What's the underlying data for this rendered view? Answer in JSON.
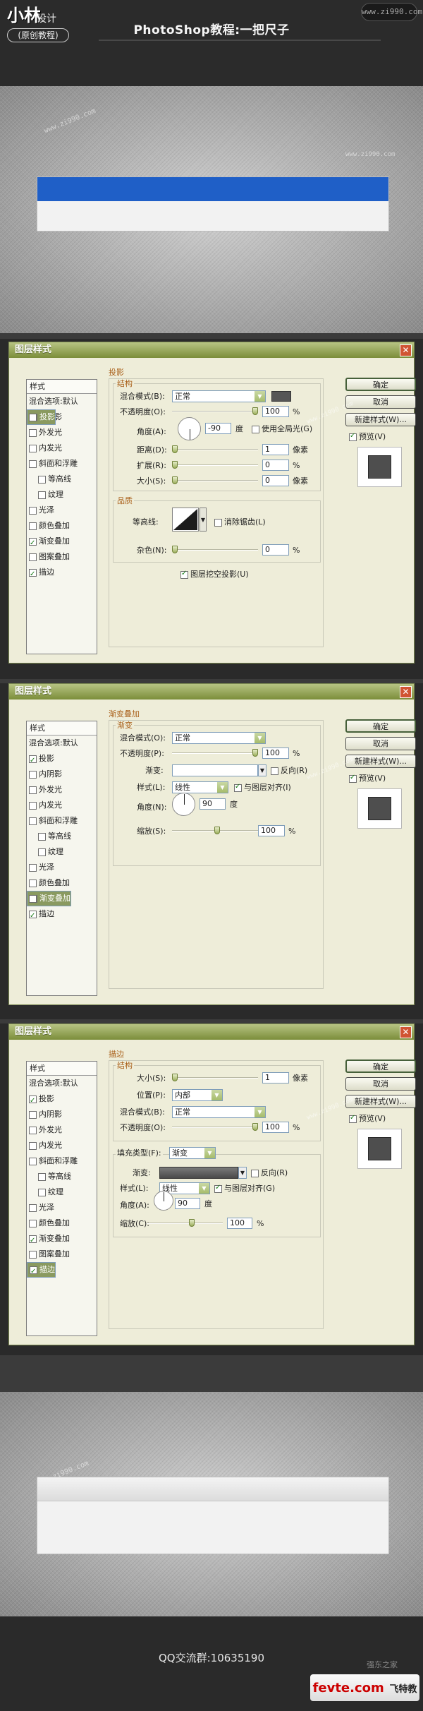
{
  "header": {
    "logo": "小林",
    "logo_sub": "设计",
    "badge": "(原创教程)",
    "title": "PhotoShop教程:一把尺子",
    "site": "www.zi990.com",
    "site_small": "www.zi990.com"
  },
  "watermark": "www.zi990.com",
  "dialogs": [
    {
      "title": "图层样式",
      "close": "✕",
      "sidebar_header": "样式",
      "sidebar": [
        {
          "label": "混合选项:默认",
          "check": false,
          "sub": false,
          "selected": false,
          "hasbox": false
        },
        {
          "label": "投影",
          "check": true,
          "sub": false,
          "selected": true,
          "hasbox": true
        },
        {
          "label": "内阴影",
          "check": false,
          "sub": false,
          "selected": false,
          "hasbox": true
        },
        {
          "label": "外发光",
          "check": false,
          "sub": false,
          "selected": false,
          "hasbox": true
        },
        {
          "label": "内发光",
          "check": false,
          "sub": false,
          "selected": false,
          "hasbox": true
        },
        {
          "label": "斜面和浮雕",
          "check": false,
          "sub": false,
          "selected": false,
          "hasbox": true
        },
        {
          "label": "等高线",
          "check": false,
          "sub": true,
          "selected": false,
          "hasbox": true
        },
        {
          "label": "纹理",
          "check": false,
          "sub": true,
          "selected": false,
          "hasbox": true
        },
        {
          "label": "光泽",
          "check": false,
          "sub": false,
          "selected": false,
          "hasbox": true
        },
        {
          "label": "颜色叠加",
          "check": false,
          "sub": false,
          "selected": false,
          "hasbox": true
        },
        {
          "label": "渐变叠加",
          "check": true,
          "sub": false,
          "selected": false,
          "hasbox": true
        },
        {
          "label": "图案叠加",
          "check": false,
          "sub": false,
          "selected": false,
          "hasbox": true
        },
        {
          "label": "描边",
          "check": true,
          "sub": false,
          "selected": false,
          "hasbox": true
        }
      ],
      "buttons": {
        "ok": "确定",
        "cancel": "取消",
        "new_style": "新建样式(W)...",
        "preview": "预览(V)"
      },
      "panel": {
        "group": "投影",
        "section": "结构",
        "blend_label": "混合模式(B):",
        "blend_value": "正常",
        "opacity_label": "不透明度(O):",
        "opacity_value": "100",
        "opacity_unit": "%",
        "angle_label": "角度(A):",
        "angle_value": "-90",
        "angle_unit": "度",
        "global_light": "使用全局光(G)",
        "distance_label": "距离(D):",
        "distance_value": "1",
        "distance_unit": "像素",
        "spread_label": "扩展(R):",
        "spread_value": "0",
        "spread_unit": "%",
        "size_label": "大小(S):",
        "size_value": "0",
        "size_unit": "像素",
        "quality": "品质",
        "contour_label": "等高线:",
        "antialias": "消除锯齿(L)",
        "noise_label": "杂色(N):",
        "noise_value": "0",
        "noise_unit": "%",
        "knockout": "图层挖空投影(U)"
      }
    },
    {
      "title": "图层样式",
      "close": "✕",
      "sidebar_header": "样式",
      "sidebar": [
        {
          "label": "混合选项:默认",
          "check": false,
          "sub": false,
          "selected": false,
          "hasbox": false
        },
        {
          "label": "投影",
          "check": true,
          "sub": false,
          "selected": false,
          "hasbox": true
        },
        {
          "label": "内阴影",
          "check": false,
          "sub": false,
          "selected": false,
          "hasbox": true
        },
        {
          "label": "外发光",
          "check": false,
          "sub": false,
          "selected": false,
          "hasbox": true
        },
        {
          "label": "内发光",
          "check": false,
          "sub": false,
          "selected": false,
          "hasbox": true
        },
        {
          "label": "斜面和浮雕",
          "check": false,
          "sub": false,
          "selected": false,
          "hasbox": true
        },
        {
          "label": "等高线",
          "check": false,
          "sub": true,
          "selected": false,
          "hasbox": true
        },
        {
          "label": "纹理",
          "check": false,
          "sub": true,
          "selected": false,
          "hasbox": true
        },
        {
          "label": "光泽",
          "check": false,
          "sub": false,
          "selected": false,
          "hasbox": true
        },
        {
          "label": "颜色叠加",
          "check": false,
          "sub": false,
          "selected": false,
          "hasbox": true
        },
        {
          "label": "渐变叠加",
          "check": true,
          "sub": false,
          "selected": true,
          "hasbox": true
        },
        {
          "label": "图案叠加",
          "check": false,
          "sub": false,
          "selected": false,
          "hasbox": true
        },
        {
          "label": "描边",
          "check": true,
          "sub": false,
          "selected": false,
          "hasbox": true
        }
      ],
      "buttons": {
        "ok": "确定",
        "cancel": "取消",
        "new_style": "新建样式(W)...",
        "preview": "预览(V)"
      },
      "panel": {
        "group": "渐变叠加",
        "section": "渐变",
        "blend_label": "混合模式(O):",
        "blend_value": "正常",
        "opacity_label": "不透明度(P):",
        "opacity_value": "100",
        "opacity_unit": "%",
        "gradient_label": "渐变:",
        "reverse": "反向(R)",
        "style_label": "样式(L):",
        "style_value": "线性",
        "align": "与图层对齐(I)",
        "angle_label": "角度(N):",
        "angle_value": "90",
        "angle_unit": "度",
        "scale_label": "缩放(S):",
        "scale_value": "100",
        "scale_unit": "%"
      }
    },
    {
      "title": "图层样式",
      "close": "✕",
      "sidebar_header": "样式",
      "sidebar": [
        {
          "label": "混合选项:默认",
          "check": false,
          "sub": false,
          "selected": false,
          "hasbox": false
        },
        {
          "label": "投影",
          "check": true,
          "sub": false,
          "selected": false,
          "hasbox": true
        },
        {
          "label": "内阴影",
          "check": false,
          "sub": false,
          "selected": false,
          "hasbox": true
        },
        {
          "label": "外发光",
          "check": false,
          "sub": false,
          "selected": false,
          "hasbox": true
        },
        {
          "label": "内发光",
          "check": false,
          "sub": false,
          "selected": false,
          "hasbox": true
        },
        {
          "label": "斜面和浮雕",
          "check": false,
          "sub": false,
          "selected": false,
          "hasbox": true
        },
        {
          "label": "等高线",
          "check": false,
          "sub": true,
          "selected": false,
          "hasbox": true
        },
        {
          "label": "纹理",
          "check": false,
          "sub": true,
          "selected": false,
          "hasbox": true
        },
        {
          "label": "光泽",
          "check": false,
          "sub": false,
          "selected": false,
          "hasbox": true
        },
        {
          "label": "颜色叠加",
          "check": false,
          "sub": false,
          "selected": false,
          "hasbox": true
        },
        {
          "label": "渐变叠加",
          "check": true,
          "sub": false,
          "selected": false,
          "hasbox": true
        },
        {
          "label": "图案叠加",
          "check": false,
          "sub": false,
          "selected": false,
          "hasbox": true
        },
        {
          "label": "描边",
          "check": true,
          "sub": false,
          "selected": true,
          "hasbox": true
        }
      ],
      "buttons": {
        "ok": "确定",
        "cancel": "取消",
        "new_style": "新建样式(W)...",
        "preview": "预览(V)"
      },
      "panel": {
        "group": "描边",
        "section": "结构",
        "size_label": "大小(S):",
        "size_value": "1",
        "size_unit": "像素",
        "position_label": "位置(P):",
        "position_value": "内部",
        "blend_label": "混合模式(B):",
        "blend_value": "正常",
        "opacity_label": "不透明度(O):",
        "opacity_value": "100",
        "opacity_unit": "%",
        "fill_label": "填充类型(F):",
        "fill_value": "渐变",
        "gradient_label": "渐变:",
        "reverse": "反向(R)",
        "style_label": "样式(L):",
        "style_value": "线性",
        "align": "与图层对齐(G)",
        "angle_label": "角度(A):",
        "angle_value": "90",
        "angle_unit": "度",
        "scale_label": "缩放(C):",
        "scale_value": "100",
        "scale_unit": "%"
      }
    }
  ],
  "footer": {
    "qq": "QQ交流群:10635190",
    "brand": "fevte.com",
    "brand_cn": "飞特教程网",
    "brand_small": "强东之家"
  },
  "colors": {
    "accent_blue": "#1f5fc7",
    "titlebar": "#8a9a60",
    "close": "#d05433"
  }
}
